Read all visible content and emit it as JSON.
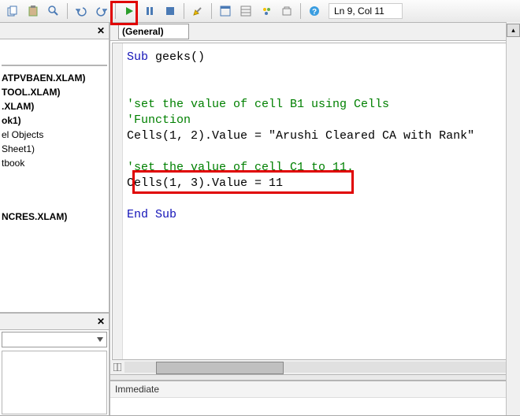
{
  "toolbar": {
    "status": "Ln 9, Col 11"
  },
  "object_selector": "(General)",
  "cursor": {
    "line": 9,
    "col": 11
  },
  "tree": {
    "items": [
      "ATPVBAEN.XLAM)",
      "TOOL.XLAM)",
      ".XLAM)",
      "ok1)",
      "el Objects",
      "Sheet1)",
      "tbook",
      "NCRES.XLAM)"
    ]
  },
  "code": {
    "l1_kw": "Sub",
    "l1_rest": " geeks()",
    "l2": "",
    "l3": "",
    "l4_cm": "'set the value of cell B1 using Cells",
    "l5_cm": "'Function",
    "l6": "Cells(1, 2).Value = \"Arushi Cleared CA with Rank\"",
    "l7": "",
    "l8_cm": "'set the value of cell C1 to 11.",
    "l9": "Cells(1, 3).Value = 11",
    "l10": "",
    "l11_kw": "End Sub"
  },
  "immediate": {
    "title": "Immediate"
  }
}
